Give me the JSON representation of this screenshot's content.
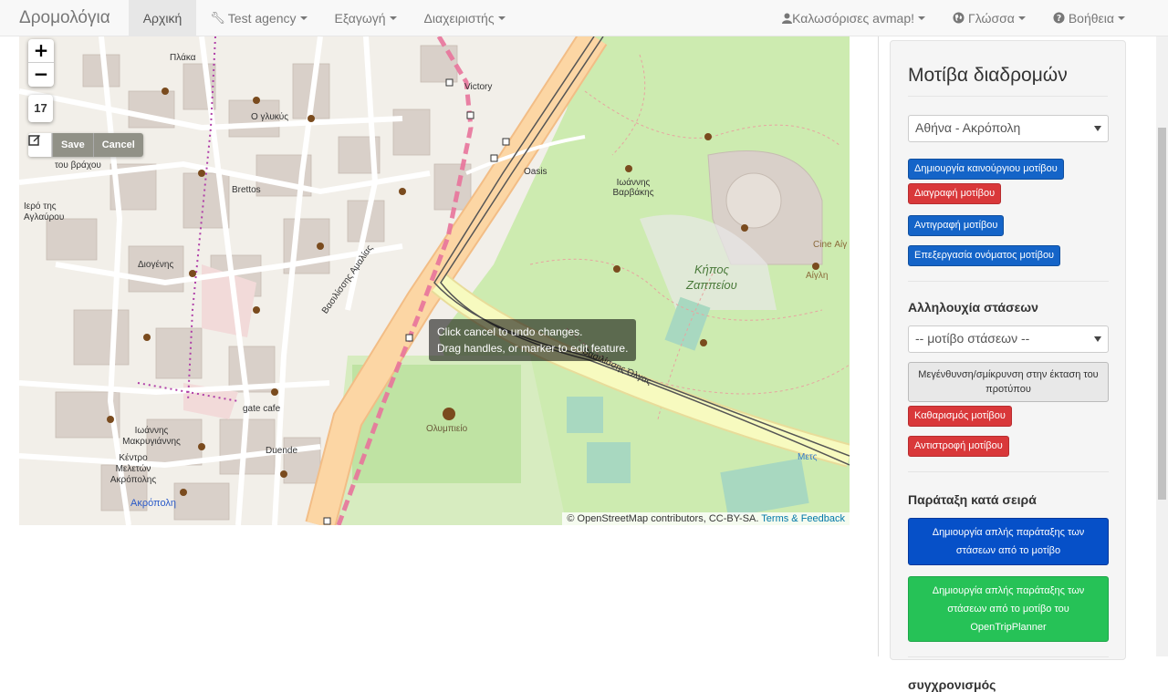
{
  "navbar": {
    "brand": "Δρομολόγια",
    "home": "Αρχική",
    "agency": "Test agency",
    "export": "Εξαγωγή",
    "admin": "Διαχειριστής",
    "welcome": "Καλωσόρισες avmap!",
    "language": "Γλώσσα",
    "help": "Βοήθεια"
  },
  "map": {
    "zoom_in": "+",
    "zoom_out": "−",
    "zoom_level": "17",
    "save": "Save",
    "cancel": "Cancel",
    "tooltip_line1": "Click cancel to undo changes.",
    "tooltip_line2": "Drag handles, or marker to edit feature.",
    "attribution": "© OpenStreetMap contributors, CC-BY-SA.",
    "attribution_link": "Terms & Feedback",
    "labels": {
      "park": "Κήπος",
      "park2": "Ζαππείου",
      "olympieion": "Ολυμπιείο",
      "acropolis": "Ακρόπολη",
      "oasis": "Oasis",
      "zappeion": "Ιωάννης Βαρβάκης",
      "plaka": "Πλάκα",
      "victory": "Victory",
      "olglykus": "Ο γλυκύς",
      "brettos": "Brettos",
      "gatecafe": "gate cafe",
      "duende": "Duende",
      "cine": "Cine Αίγ",
      "aigli": "Αίγλη",
      "amalias": "Βασιλίσσης Αμαλίας",
      "olgas": "Βασιλίσσης Όλγας",
      "museum": "Κέντρο Μελετών Ακρόπολης",
      "makrigianni": "Ιωάννης Μακρυγιάννης",
      "ieroavl": "Ιερό της Αγλαύρου",
      "metro": "Μετς",
      "tou_vraxou": "του βράχου",
      "dionysos": "Διογένης"
    }
  },
  "panel": {
    "title": "Μοτίβα διαδρομών",
    "pattern_select": "Αθήνα - Ακρόπολη",
    "btn_new": "Δημιουργία καινούργιου μοτίβου",
    "btn_delete": "Διαγραφή μοτίβου",
    "btn_copy": "Αντιγραφή μοτίβου",
    "btn_rename": "Επεξεργασία ονόματος μοτίβου",
    "stops_title": "Αλληλουχία στάσεων",
    "stops_select": "-- μοτίβο στάσεων --",
    "btn_zoom": "Μεγένθυνση/σμίκρυνση στην έκταση του προτύπου",
    "btn_clear": "Καθαρισμός μοτίβου",
    "btn_reverse": "Αντιστροφή μοτίβου",
    "order_title": "Παράταξη κατά σειρά",
    "btn_order_simple": "Δημιουργία απλής παράταξης των στάσεων από το μοτίβο",
    "btn_order_otp": "Δημιουργία απλής παράταξης των στάσεων από το μοτίβο του OpenTripPlanner",
    "sync_title": "συγχρονισμός"
  },
  "colors": {
    "road_main": "#fcd6a4",
    "park": "#cdebb0",
    "pattern_line": "#e8739b",
    "primary": "#1464c8",
    "danger": "#d9383a",
    "success": "#26c257"
  }
}
